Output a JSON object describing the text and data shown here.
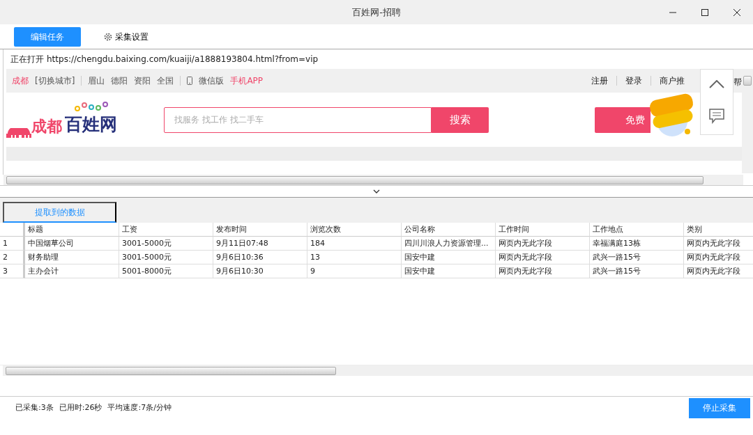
{
  "window": {
    "title": "百姓网-招聘"
  },
  "toolbar": {
    "tabs": [
      {
        "label": "编辑任务",
        "selected": true,
        "kind": "plain"
      },
      {
        "label": "采集设置",
        "selected": false,
        "kind": "gear"
      }
    ]
  },
  "browser": {
    "status_label": "正在打开",
    "url": "https://chengdu.baixing.com/kuaiji/a1888193804.html?from=vip",
    "left_links": [
      {
        "label": "成都",
        "kind": "hot"
      },
      {
        "label": "[切换城市]",
        "kind": "text"
      },
      {
        "kind": "sep"
      },
      {
        "label": "眉山",
        "kind": "text"
      },
      {
        "label": "德阳",
        "kind": "text"
      },
      {
        "label": "资阳",
        "kind": "text"
      },
      {
        "label": "全国",
        "kind": "text"
      },
      {
        "kind": "sep"
      },
      {
        "label": "微信版",
        "kind": "phone"
      },
      {
        "label": "手机APP",
        "kind": "hot"
      }
    ],
    "right_links": [
      {
        "label": "注册",
        "kind": "text"
      },
      {
        "kind": "sep"
      },
      {
        "label": "登录",
        "kind": "text"
      },
      {
        "kind": "sep"
      },
      {
        "label": "商户推",
        "kind": "text"
      }
    ],
    "edge_link": "帮",
    "logo": {
      "city": "成都",
      "name": "百姓网"
    },
    "search": {
      "placeholder": "找服务 找工作 找二手车",
      "button": "搜索"
    },
    "post_button": "免费"
  },
  "results": {
    "tab": "提取到的数据",
    "columns": [
      "标题",
      "工资",
      "发布时间",
      "浏览次数",
      "公司名称",
      "工作时间",
      "工作地点",
      "类别"
    ],
    "rows": [
      {
        "index": "1",
        "cells": [
          "中国烟草公司",
          "3001-5000元",
          "9月11日07:48",
          "184",
          "四川川浪人力资源管理...",
          "网页内无此字段",
          "幸福满庭13栋",
          "网页内无此字段"
        ]
      },
      {
        "index": "2",
        "cells": [
          "财务助理",
          "3001-5000元",
          "9月6日10:36",
          "13",
          "国安中建",
          "网页内无此字段",
          "武兴一路15号",
          "网页内无此字段"
        ]
      },
      {
        "index": "3",
        "cells": [
          "主办会计",
          "5001-8000元",
          "9月6日10:30",
          "9",
          "国安中建",
          "网页内无此字段",
          "武兴一路15号",
          "网页内无此字段"
        ]
      }
    ]
  },
  "status_bar": {
    "items": [
      "已采集:3条",
      "已用时:26秒",
      "平均速度:7条/分钟"
    ],
    "button": "停止采集"
  }
}
